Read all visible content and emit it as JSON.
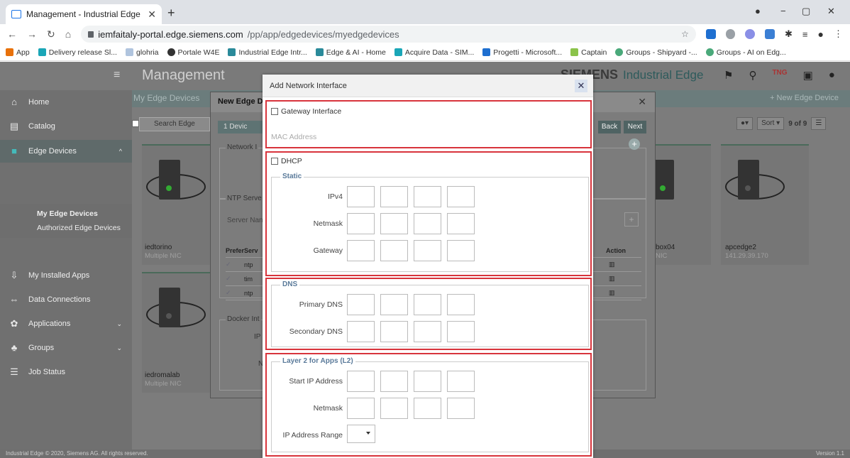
{
  "browser": {
    "tab_title": "Management - Industrial Edge",
    "url_host": "iemfaitaly-portal.edge.siemens.com",
    "url_path": "/pp/app/edgedevices/myedgedevices",
    "bookmarks": [
      "App",
      "Delivery release Sl...",
      "glohria",
      "Portale W4E",
      "Industrial Edge Intr...",
      "Edge & AI - Home",
      "Acquire Data - SIM...",
      "Progetti - Microsoft...",
      "Captain",
      "Groups - Shipyard -...",
      "Groups - AI on Edg..."
    ]
  },
  "app": {
    "title": "Management",
    "brand_name": "SIEMENS",
    "brand_product": "Industrial Edge",
    "badge": "TNG",
    "footer": "Industrial Edge © 2020, Siemens AG. All rights reserved.",
    "version": "Version 1.1"
  },
  "sidebar": {
    "items": [
      {
        "label": "Home",
        "icon": "home-icon"
      },
      {
        "label": "Catalog",
        "icon": "catalog-icon"
      },
      {
        "label": "Edge Devices",
        "icon": "edge-devices-icon"
      },
      {
        "label": "My Installed Apps",
        "icon": "installed-apps-icon"
      },
      {
        "label": "Data Connections",
        "icon": "data-connections-icon"
      },
      {
        "label": "Applications",
        "icon": "applications-icon"
      },
      {
        "label": "Groups",
        "icon": "groups-icon"
      },
      {
        "label": "Job Status",
        "icon": "job-status-icon"
      }
    ],
    "sub_items": [
      "My Edge Devices",
      "Authorized Edge Devices"
    ]
  },
  "content": {
    "breadcrumb": "My Edge Devices",
    "new_device": "+ New Edge Device",
    "search_placeholder": "Search Edge",
    "sort_label": "Sort",
    "count": "9 of 9",
    "devices": [
      {
        "name": "iedtorino",
        "sub": "Multiple NIC"
      },
      {
        "name": "iedromalab",
        "sub": "Multiple NIC"
      },
      {
        "name": "box04",
        "sub": "NIC"
      },
      {
        "name": "apcedge2",
        "sub": "141.29.39.170"
      }
    ]
  },
  "bg_dialog": {
    "title": "New Edge De",
    "step": "1  Devic",
    "back": "Back",
    "next": "Next",
    "fs_network": "Network I",
    "fs_ntp": "NTP Serve",
    "server_name": "Server Nan",
    "fs_docker": "Docker Int",
    "docker_ip": "IP",
    "docker_n": "N",
    "col_prefer": "Prefer",
    "col_server": "Serv",
    "col_action": "Action",
    "ntp_rows": [
      "ntp",
      "tim",
      "ntp"
    ]
  },
  "modal": {
    "title": "Add Network Interface",
    "gateway_interface": "Gateway Interface",
    "mac_placeholder": "MAC Address",
    "dhcp": "DHCP",
    "static_legend": "Static",
    "ipv4": "IPv4",
    "netmask": "Netmask",
    "gateway": "Gateway",
    "dns_legend": "DNS",
    "primary_dns": "Primary DNS",
    "secondary_dns": "Secondary DNS",
    "l2_legend": "Layer 2 for Apps (L2)",
    "start_ip": "Start IP Address",
    "l2_netmask": "Netmask",
    "ip_range": "IP Address Range"
  }
}
